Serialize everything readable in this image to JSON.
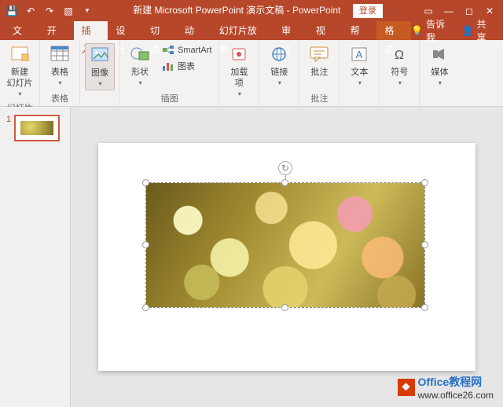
{
  "titlebar": {
    "doc_name": "新建 Microsoft PowerPoint 演示文稿",
    "app_name": "PowerPoint",
    "login": "登录"
  },
  "tabs": {
    "file": "文件",
    "home": "开始",
    "insert": "插入",
    "design": "设计",
    "transitions": "切换",
    "animations": "动画",
    "slideshow": "幻灯片放映",
    "review": "审阅",
    "view": "视图",
    "help": "帮助",
    "format": "格式",
    "tellme": "告诉我",
    "share": "共享"
  },
  "ribbon": {
    "new_slide": "新建\n幻灯片",
    "slides_group": "幻灯片",
    "table": "表格",
    "table_group": "表格",
    "images": "图像",
    "shapes": "形状",
    "smartart": "SmartArt",
    "chart": "图表",
    "illustrations_group": "插图",
    "addins": "加载\n项",
    "links": "链接",
    "comments": "批注",
    "comments_group": "批注",
    "text": "文本",
    "symbols": "符号",
    "media": "媒体"
  },
  "thumbnails": {
    "slide1_num": "1"
  },
  "watermark": {
    "brand": "Office",
    "suffix": "教程网",
    "url": "www.office26.com"
  }
}
